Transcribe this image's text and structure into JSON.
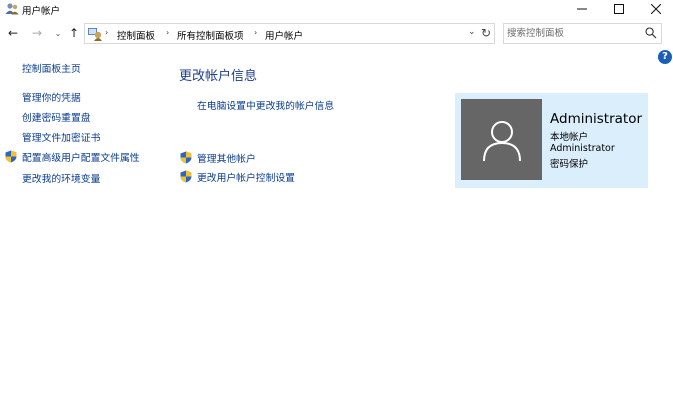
{
  "window": {
    "title": "用户帐户",
    "minimize": "—",
    "maximize": "☐",
    "close": "✕"
  },
  "toolbar": {
    "back": "←",
    "forward": "→",
    "history_dropdown": "⌄",
    "up": "↑",
    "refresh": "↻"
  },
  "breadcrumb": {
    "separator": "›",
    "items": [
      "控制面板",
      "所有控制面板项",
      "用户帐户"
    ],
    "dropdown": "⌄"
  },
  "search": {
    "placeholder": "搜索控制面板"
  },
  "help": "?",
  "sidebar": {
    "items": [
      {
        "label": "控制面板主页",
        "shield": false
      },
      {
        "label": "管理你的凭据",
        "shield": false
      },
      {
        "label": "创建密码重置盘",
        "shield": false
      },
      {
        "label": "管理文件加密证书",
        "shield": false
      },
      {
        "label": "配置高级用户配置文件属性",
        "shield": true
      },
      {
        "label": "更改我的环境变量",
        "shield": false
      }
    ]
  },
  "main": {
    "heading": "更改帐户信息",
    "links": [
      {
        "label": "在电脑设置中更改我的帐户信息",
        "shield": false
      },
      {
        "label": "管理其他帐户",
        "shield": true
      },
      {
        "label": "更改用户帐户控制设置",
        "shield": true
      }
    ]
  },
  "account": {
    "name": "Administrator",
    "type": "本地帐户",
    "group": "Administrator",
    "status": "密码保护"
  },
  "colors": {
    "link": "#0f56b8",
    "heading": "#1f3e8c",
    "card_bg": "#dbeefc",
    "avatar_bg": "#666666"
  }
}
